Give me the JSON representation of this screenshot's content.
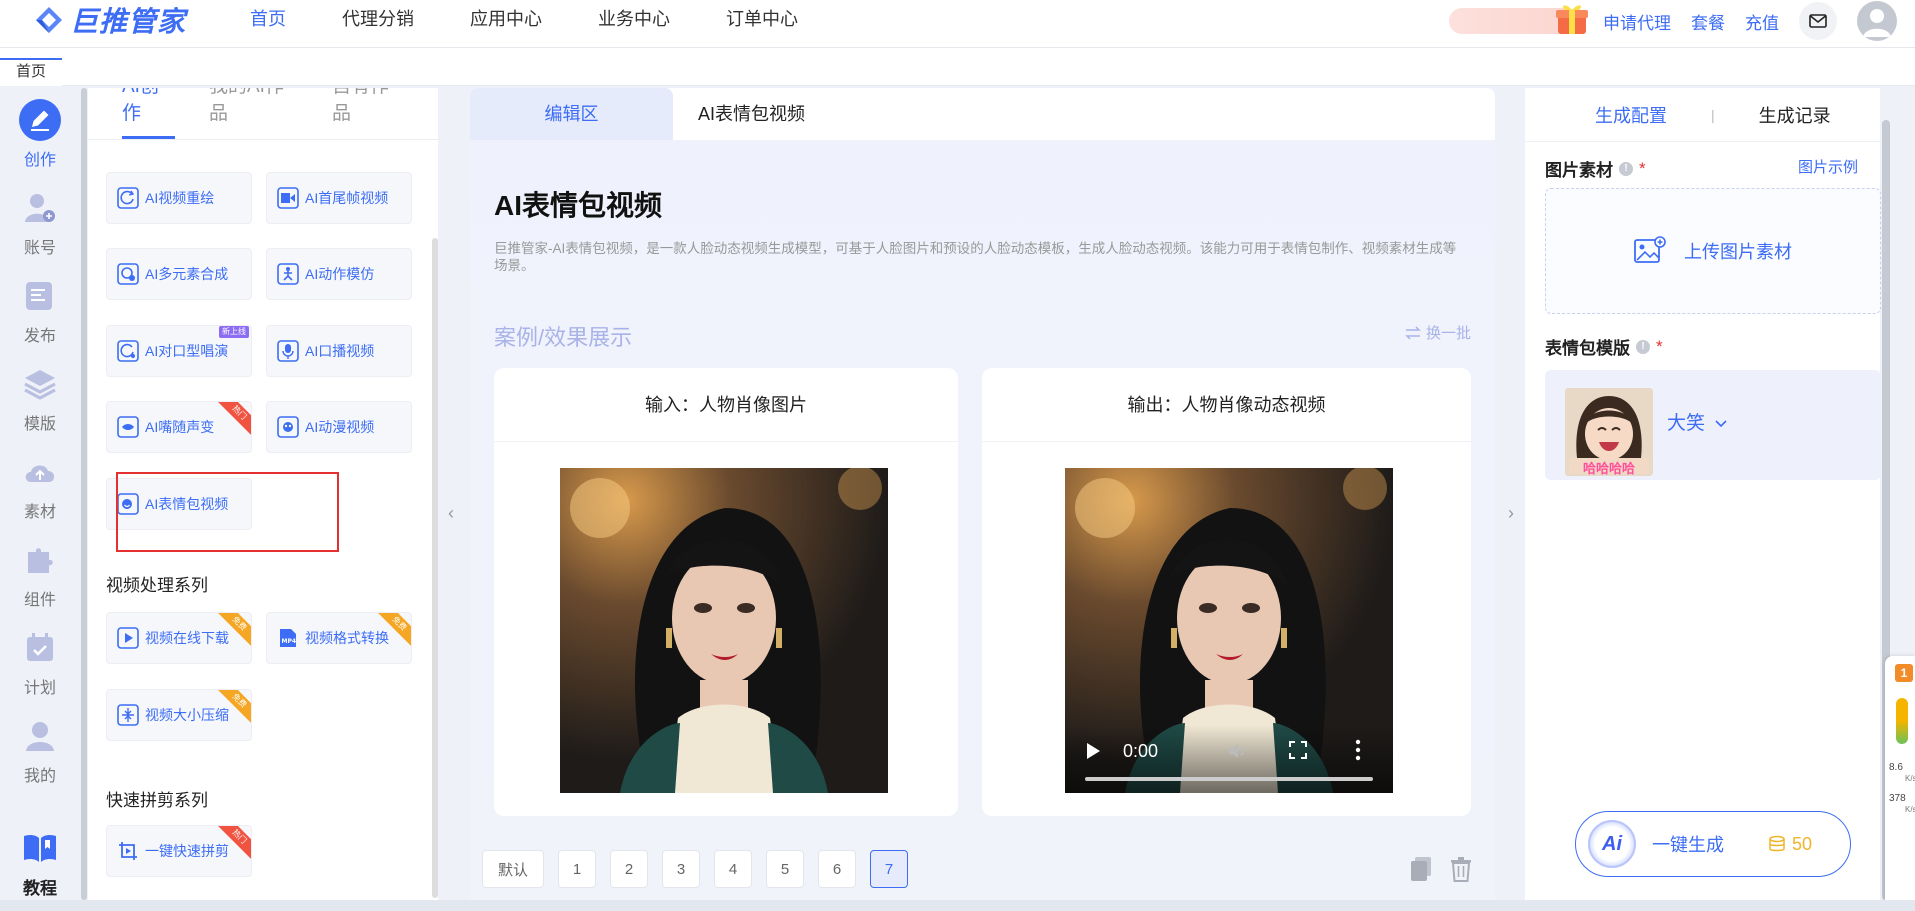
{
  "brand": {
    "name": "巨推管家",
    "color": "#3d6df5"
  },
  "nav": [
    {
      "label": "首页",
      "active": true
    },
    {
      "label": "代理分销",
      "active": false
    },
    {
      "label": "应用中心",
      "active": false
    },
    {
      "label": "业务中心",
      "active": false
    },
    {
      "label": "订单中心",
      "active": false
    }
  ],
  "top_actions": {
    "apply_agent": "申请代理",
    "package": "套餐",
    "recharge": "充值",
    "mail_icon": "mail-icon",
    "avatar_icon": "user-avatar-icon"
  },
  "page_tabs": [
    {
      "label": "首页"
    }
  ],
  "rail": [
    {
      "label": "创作",
      "icon": "pencil-icon",
      "active": true
    },
    {
      "label": "账号",
      "icon": "account-add-icon"
    },
    {
      "label": "发布",
      "icon": "publish-icon"
    },
    {
      "label": "模版",
      "icon": "layers-icon"
    },
    {
      "label": "素材",
      "icon": "cloud-upload-icon"
    },
    {
      "label": "组件",
      "icon": "puzzle-icon"
    },
    {
      "label": "计划",
      "icon": "calendar-check-icon"
    },
    {
      "label": "我的",
      "icon": "user-icon"
    },
    {
      "label": "教程",
      "icon": "book-icon"
    }
  ],
  "tools_panel": {
    "tabs": [
      {
        "label": "AI创作",
        "active": true
      },
      {
        "label": "我的AI作品"
      },
      {
        "label": "自有作品"
      }
    ],
    "ai_tools": [
      {
        "label": "AI视频重绘",
        "icon": "video-redraw-icon"
      },
      {
        "label": "AI首尾帧视频",
        "icon": "frame-video-icon"
      },
      {
        "label": "AI多元素合成",
        "icon": "compose-icon"
      },
      {
        "label": "AI动作模仿",
        "icon": "motion-icon"
      },
      {
        "label": "AI对口型唱演",
        "icon": "lipsync-icon",
        "tag": "新上线"
      },
      {
        "label": "AI口播视频",
        "icon": "mic-icon"
      },
      {
        "label": "AI嘴随声变",
        "icon": "mouth-icon",
        "ribbon": "热门"
      },
      {
        "label": "AI动漫视频",
        "icon": "anime-icon"
      },
      {
        "label": "AI表情包视频",
        "icon": "emoji-video-icon",
        "selected": true
      }
    ],
    "video_section_title": "视频处理系列",
    "video_tools": [
      {
        "label": "视频在线下载",
        "icon": "video-download-icon",
        "ribbon": "免费"
      },
      {
        "label": "视频格式转换",
        "icon": "mp4-icon",
        "ribbon": "免费"
      },
      {
        "label": "视频大小压缩",
        "icon": "compress-icon",
        "ribbon": "免费"
      }
    ],
    "quick_section_title": "快速拼剪系列",
    "quick_tools": [
      {
        "label": "一键快速拼剪",
        "icon": "crop-icon",
        "ribbon": "热门"
      }
    ]
  },
  "editor": {
    "tabs": [
      {
        "label": "编辑区",
        "active": true
      },
      {
        "label": "AI表情包视频"
      }
    ],
    "title": "AI表情包视频",
    "description": "巨推管家-AI表情包视频，是一款人脸动态视频生成模型，可基于人脸图片和预设的人脸动态模板，生成人脸动态视频。该能力可用于表情包制作、视频素材生成等场景。",
    "case_title": "案例/效果展示",
    "swap_label": "换一批",
    "input_card_title": "输入：人物肖像图片",
    "output_card_title": "输出：人物肖像动态视频",
    "video_time": "0:00",
    "pager": {
      "default_label": "默认",
      "pages": [
        "1",
        "2",
        "3",
        "4",
        "5",
        "6",
        "7"
      ],
      "current": "7"
    }
  },
  "config": {
    "tabs": [
      {
        "label": "生成配置",
        "active": true
      },
      {
        "label": "生成记录"
      }
    ],
    "image_label": "图片素材",
    "required_mark": "*",
    "example_link": "图片示例",
    "upload_text": "上传图片素材",
    "template_label": "表情包模版",
    "template_name": "大笑",
    "template_caption": "哈哈哈哈",
    "generate_label": "一键生成",
    "cost": "50"
  },
  "float_widget": {
    "badge": "1",
    "up_value": "8.6",
    "down_value": "378",
    "unit": "K/s"
  }
}
